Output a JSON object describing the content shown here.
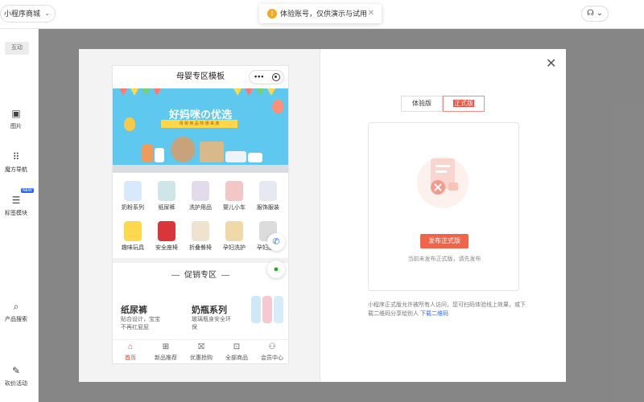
{
  "topbar": {
    "store_name": "小程序商城",
    "notice": "体验账号，仅供演示与试用",
    "user_icon": "headset-icon"
  },
  "sidebar": {
    "tab": "互动",
    "items": [
      {
        "label": "图片",
        "icon": "image-icon"
      },
      {
        "label": "魔方导航",
        "icon": "grid-icon"
      },
      {
        "label": "标签模块",
        "icon": "list-icon",
        "badge": "NEW"
      },
      {
        "label": "产品搜索",
        "icon": "search-grid-icon"
      },
      {
        "label": "砍价活动",
        "icon": "edit-icon"
      }
    ]
  },
  "phone": {
    "title": "母婴专区模板",
    "banner_title": "好妈咪の优选",
    "banner_sub": "母 婴 用 品 特 惠 来 袭",
    "categories": [
      "奶粉系列",
      "纸尿裤",
      "洗护用品",
      "婴儿小车",
      "服饰服装",
      "趣味玩具",
      "安全座椅",
      "折叠餐椅",
      "孕妇洗护",
      "孕妇服饰"
    ],
    "promo_title": "促销专区",
    "promo1_title": "纸尿裤",
    "promo1_desc": "贴合设计，宝宝不再红屁屁",
    "promo2_title": "奶瓶系列",
    "promo2_desc": "玻璃瓶身安全环保",
    "tabs": [
      "首页",
      "新品推荐",
      "优惠抢购",
      "全部商品",
      "会员中心"
    ]
  },
  "modal": {
    "close_icon": "close-icon",
    "seg_trial": "体验版",
    "seg_release": "正式版",
    "publish_button": "发布正式版",
    "hint": "当前未发布正式版，请先发布",
    "desc": "小程序正式版允许被所有人访问，您可扫码体验线上效果，或下载二维码分享给别人",
    "desc_link": "下载二维码"
  },
  "colors": {
    "accent": "#e84c3d",
    "link": "#2a6bf2",
    "banner_bg": "#5ec8ef"
  }
}
